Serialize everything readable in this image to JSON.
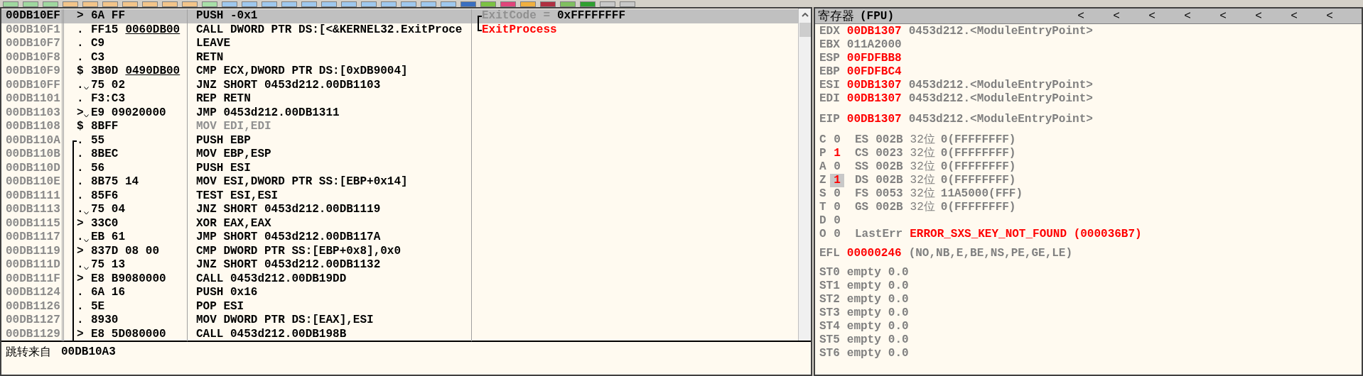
{
  "disassembly": {
    "rows": [
      {
        "address": "00DB10EF",
        "selected": true,
        "bracket": false,
        "bracket_start": false,
        "marker": ">",
        "jump": false,
        "hex": "6A FF",
        "instruction": "PUSH -0x1",
        "comment": {
          "kind": "argument",
          "label": "ExitCode =",
          "value": "0xFFFFFFFF"
        }
      },
      {
        "address": "00DB10F1",
        "selected": false,
        "bracket": false,
        "bracket_start": false,
        "marker": ".",
        "jump": false,
        "hex": "FF15",
        "operand": "0060DB00",
        "instruction": "CALL DWORD PTR DS:[<&KERNEL32.ExitProce",
        "comment": {
          "kind": "api",
          "label": "ExitProcess"
        }
      },
      {
        "address": "00DB10F7",
        "selected": false,
        "bracket": false,
        "bracket_start": false,
        "marker": ".",
        "jump": false,
        "hex": "C9",
        "instruction": "LEAVE"
      },
      {
        "address": "00DB10F8",
        "selected": false,
        "bracket": false,
        "bracket_start": false,
        "marker": ".",
        "jump": false,
        "hex": "C3",
        "instruction": "RETN"
      },
      {
        "address": "00DB10F9",
        "selected": false,
        "bracket": false,
        "bracket_start": false,
        "marker": "$",
        "jump": false,
        "hex": "3B0D",
        "operand": "0490DB00",
        "instruction": "CMP ECX,DWORD PTR DS:[0xDB9004]"
      },
      {
        "address": "00DB10FF",
        "selected": false,
        "bracket": false,
        "bracket_start": false,
        "marker": ".",
        "jump": true,
        "hex": "75 02",
        "instruction": "JNZ SHORT 0453d212.00DB1103"
      },
      {
        "address": "00DB1101",
        "selected": false,
        "bracket": false,
        "bracket_start": false,
        "marker": ".",
        "jump": false,
        "hex": "F3:C3",
        "instruction": "REP RETN"
      },
      {
        "address": "00DB1103",
        "selected": false,
        "bracket": false,
        "bracket_start": false,
        "marker": ">",
        "jump": true,
        "hex": "E9 09020000",
        "instruction": "JMP 0453d212.00DB1311"
      },
      {
        "address": "00DB1108",
        "selected": false,
        "bracket": false,
        "bracket_start": false,
        "marker": "$",
        "jump": false,
        "hex": "8BFF",
        "instruction": "MOV EDI,EDI",
        "muted": true
      },
      {
        "address": "00DB110A",
        "selected": false,
        "bracket": true,
        "bracket_start": true,
        "marker": ".",
        "jump": false,
        "hex": "55",
        "instruction": "PUSH EBP"
      },
      {
        "address": "00DB110B",
        "selected": false,
        "bracket": true,
        "bracket_start": false,
        "marker": ".",
        "jump": false,
        "hex": "8BEC",
        "instruction": "MOV EBP,ESP"
      },
      {
        "address": "00DB110D",
        "selected": false,
        "bracket": true,
        "bracket_start": false,
        "marker": ".",
        "jump": false,
        "hex": "56",
        "instruction": "PUSH ESI"
      },
      {
        "address": "00DB110E",
        "selected": false,
        "bracket": true,
        "bracket_start": false,
        "marker": ".",
        "jump": false,
        "hex": "8B75 14",
        "instruction": "MOV ESI,DWORD PTR SS:[EBP+0x14]"
      },
      {
        "address": "00DB1111",
        "selected": false,
        "bracket": true,
        "bracket_start": false,
        "marker": ".",
        "jump": false,
        "hex": "85F6",
        "instruction": "TEST ESI,ESI"
      },
      {
        "address": "00DB1113",
        "selected": false,
        "bracket": true,
        "bracket_start": false,
        "marker": ".",
        "jump": true,
        "hex": "75 04",
        "instruction": "JNZ SHORT 0453d212.00DB1119"
      },
      {
        "address": "00DB1115",
        "selected": false,
        "bracket": true,
        "bracket_start": false,
        "marker": ">",
        "jump": false,
        "hex": "33C0",
        "instruction": "XOR EAX,EAX"
      },
      {
        "address": "00DB1117",
        "selected": false,
        "bracket": true,
        "bracket_start": false,
        "marker": ".",
        "jump": true,
        "hex": "EB 61",
        "instruction": "JMP SHORT 0453d212.00DB117A"
      },
      {
        "address": "00DB1119",
        "selected": false,
        "bracket": true,
        "bracket_start": false,
        "marker": ">",
        "jump": false,
        "hex": "837D 08 00",
        "instruction": "CMP DWORD PTR SS:[EBP+0x8],0x0"
      },
      {
        "address": "00DB111D",
        "selected": false,
        "bracket": true,
        "bracket_start": false,
        "marker": ".",
        "jump": true,
        "hex": "75 13",
        "instruction": "JNZ SHORT 0453d212.00DB1132"
      },
      {
        "address": "00DB111F",
        "selected": false,
        "bracket": true,
        "bracket_start": false,
        "marker": ">",
        "jump": false,
        "hex": "E8 B9080000",
        "instruction": "CALL 0453d212.00DB19DD"
      },
      {
        "address": "00DB1124",
        "selected": false,
        "bracket": true,
        "bracket_start": false,
        "marker": ".",
        "jump": false,
        "hex": "6A 16",
        "instruction": "PUSH 0x16"
      },
      {
        "address": "00DB1126",
        "selected": false,
        "bracket": true,
        "bracket_start": false,
        "marker": ".",
        "jump": false,
        "hex": "5E",
        "instruction": "POP ESI"
      },
      {
        "address": "00DB1127",
        "selected": false,
        "bracket": true,
        "bracket_start": false,
        "marker": ".",
        "jump": false,
        "hex": "8930",
        "instruction": "MOV DWORD PTR DS:[EAX],ESI"
      },
      {
        "address": "00DB1129",
        "selected": false,
        "bracket": true,
        "bracket_start": false,
        "marker": ">",
        "jump": false,
        "hex": "E8 5D080000",
        "instruction": "CALL 0453d212.00DB198B"
      }
    ]
  },
  "info": {
    "label": "跳转来自",
    "value": "00DB10A3"
  },
  "registers": {
    "title": "寄存器",
    "subtitle": "(FPU)",
    "arrows": [
      "<",
      "<",
      "<",
      "<",
      "<",
      "<",
      "<",
      "<"
    ],
    "general": [
      {
        "name": "EDX",
        "value": "00DB1307",
        "changed": true,
        "comment": "0453d212.<ModuleEntryPoint>"
      },
      {
        "name": "EBX",
        "value": "011A2000",
        "changed": false
      },
      {
        "name": "ESP",
        "value": "00FDFBB8",
        "changed": true
      },
      {
        "name": "EBP",
        "value": "00FDFBC4",
        "changed": true
      },
      {
        "name": "ESI",
        "value": "00DB1307",
        "changed": true,
        "comment": "0453d212.<ModuleEntryPoint>"
      },
      {
        "name": "EDI",
        "value": "00DB1307",
        "changed": true,
        "comment": "0453d212.<ModuleEntryPoint>"
      }
    ],
    "eip": {
      "name": "EIP",
      "value": "00DB1307",
      "changed": true,
      "comment": "0453d212.<ModuleEntryPoint>"
    },
    "flags": [
      {
        "name": "C",
        "value": "0",
        "changed": false,
        "highlighted": false,
        "segment": "ES",
        "selector": "002B",
        "bits": "32位",
        "base": "0(FFFFFFFF)"
      },
      {
        "name": "P",
        "value": "1",
        "changed": true,
        "highlighted": false,
        "segment": "CS",
        "selector": "0023",
        "bits": "32位",
        "base": "0(FFFFFFFF)"
      },
      {
        "name": "A",
        "value": "0",
        "changed": false,
        "highlighted": false,
        "segment": "SS",
        "selector": "002B",
        "bits": "32位",
        "base": "0(FFFFFFFF)"
      },
      {
        "name": "Z",
        "value": "1",
        "changed": true,
        "highlighted": true,
        "segment": "DS",
        "selector": "002B",
        "bits": "32位",
        "base": "0(FFFFFFFF)"
      },
      {
        "name": "S",
        "value": "0",
        "changed": false,
        "highlighted": false,
        "segment": "FS",
        "selector": "0053",
        "bits": "32位",
        "base": "11A5000(FFF)"
      },
      {
        "name": "T",
        "value": "0",
        "changed": false,
        "highlighted": false,
        "segment": "GS",
        "selector": "002B",
        "bits": "32位",
        "base": "0(FFFFFFFF)"
      },
      {
        "name": "D",
        "value": "0",
        "changed": false,
        "highlighted": false
      },
      {
        "name": "O",
        "value": "0",
        "changed": false,
        "highlighted": false,
        "last_error_label": "LastErr",
        "last_error": "ERROR_SXS_KEY_NOT_FOUND (000036B7)"
      }
    ],
    "efl": {
      "name": "EFL",
      "value": "00000246",
      "changed": true,
      "conditions": "(NO,NB,E,BE,NS,PE,GE,LE)"
    },
    "fpu": [
      {
        "name": "ST0",
        "tag": "empty",
        "value": "0.0"
      },
      {
        "name": "ST1",
        "tag": "empty",
        "value": "0.0"
      },
      {
        "name": "ST2",
        "tag": "empty",
        "value": "0.0"
      },
      {
        "name": "ST3",
        "tag": "empty",
        "value": "0.0"
      },
      {
        "name": "ST4",
        "tag": "empty",
        "value": "0.0"
      },
      {
        "name": "ST5",
        "tag": "empty",
        "value": "0.0"
      },
      {
        "name": "ST6",
        "tag": "empty",
        "value": "0.0"
      }
    ]
  }
}
